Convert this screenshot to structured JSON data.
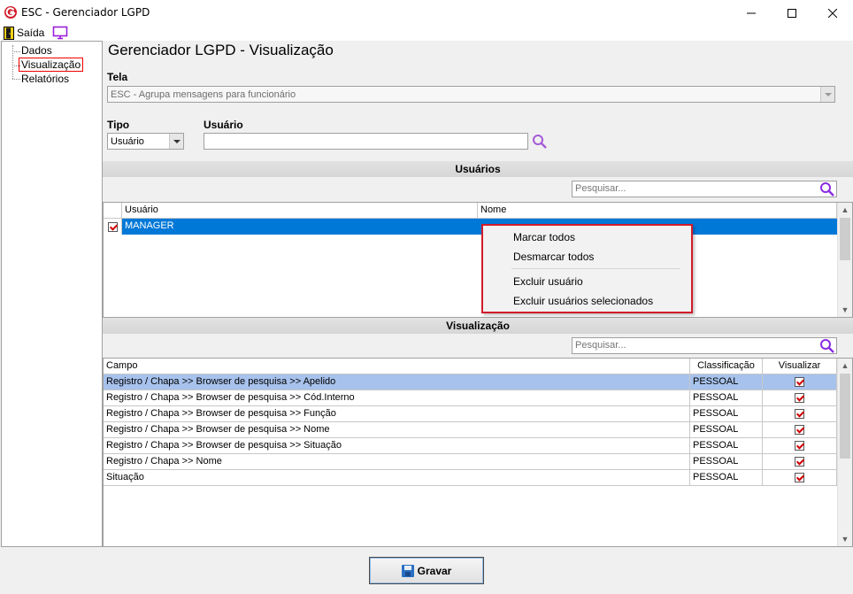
{
  "window": {
    "title": "ESC - Gerenciador LGPD",
    "buttons": [
      "minimize",
      "maximize",
      "close"
    ]
  },
  "menubar": {
    "exit_label": "Saída"
  },
  "tree": {
    "items": [
      {
        "label": "Dados"
      },
      {
        "label": "Visualização",
        "selected": true
      },
      {
        "label": "Relatórios"
      }
    ]
  },
  "main": {
    "title": "Gerenciador LGPD - Visualização",
    "tela": {
      "label": "Tela",
      "value": "ESC - Agrupa mensagens para funcionário"
    },
    "tipo": {
      "label": "Tipo",
      "value": "Usuário"
    },
    "usuario": {
      "label": "Usuário",
      "value": ""
    }
  },
  "users_section": {
    "header": "Usuários",
    "search_placeholder": "Pesquisar...",
    "columns": [
      "Usuário",
      "Nome"
    ],
    "rows": [
      {
        "checked": true,
        "usuario": "MANAGER",
        "nome": ""
      }
    ]
  },
  "context_menu": {
    "items": [
      "Marcar todos",
      "Desmarcar todos",
      "Excluir usuário",
      "Excluir usuários selecionados"
    ]
  },
  "view_section": {
    "header": "Visualização",
    "search_placeholder": "Pesquisar...",
    "columns": [
      "Campo",
      "Classificação",
      "Visualizar"
    ],
    "rows": [
      {
        "campo": "Registro / Chapa >> Browser de pesquisa >> Apelido",
        "classificacao": "PESSOAL",
        "visualizar": true
      },
      {
        "campo": "Registro / Chapa >> Browser de pesquisa >> Cód.Interno",
        "classificacao": "PESSOAL",
        "visualizar": true
      },
      {
        "campo": "Registro / Chapa >> Browser de pesquisa >> Função",
        "classificacao": "PESSOAL",
        "visualizar": true
      },
      {
        "campo": "Registro / Chapa >> Browser de pesquisa >> Nome",
        "classificacao": "PESSOAL",
        "visualizar": true
      },
      {
        "campo": "Registro / Chapa >> Browser de pesquisa >> Situação",
        "classificacao": "PESSOAL",
        "visualizar": true
      },
      {
        "campo": "Registro / Chapa >> Nome",
        "classificacao": "PESSOAL",
        "visualizar": true
      },
      {
        "campo": "Situação",
        "classificacao": "PESSOAL",
        "visualizar": true
      }
    ]
  },
  "footer": {
    "save_label": "Gravar"
  },
  "colors": {
    "selection": "#a7c2ec",
    "user_selection": "#0078d7",
    "highlight_border": "#d11c2a",
    "search_icon": "#8a2be2"
  },
  "icons": [
    "app-logo-icon",
    "exit-door-icon",
    "monitor-icon",
    "search-icon",
    "save-disk-icon"
  ]
}
